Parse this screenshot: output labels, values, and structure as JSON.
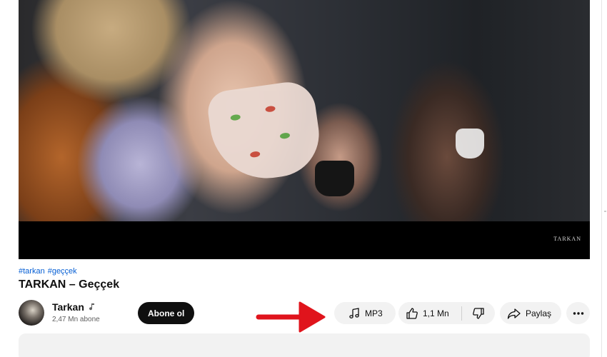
{
  "video": {
    "brand_watermark": "TARKAN"
  },
  "hashtags": [
    "#tarkan",
    "#geççek"
  ],
  "title": "TARKAN – Geççek",
  "channel": {
    "name": "Tarkan",
    "subscribers": "2,47 Mn abone",
    "subscribe_label": "Abone ol"
  },
  "actions": {
    "mp3_label": "MP3",
    "like_count": "1,1 Mn",
    "share_label": "Paylaş"
  },
  "icons": {
    "music_note": "music-note-icon",
    "like": "thumbs-up-icon",
    "dislike": "thumbs-down-icon",
    "share": "share-arrow-icon",
    "more": "more-horizontal-icon",
    "verified_artist": "music-badge-icon"
  },
  "colors": {
    "hashtag": "#065fd4",
    "subscribe_bg": "#0f0f0f",
    "pill_bg": "#f2f2f2",
    "annotation_arrow": "#e0141c"
  }
}
